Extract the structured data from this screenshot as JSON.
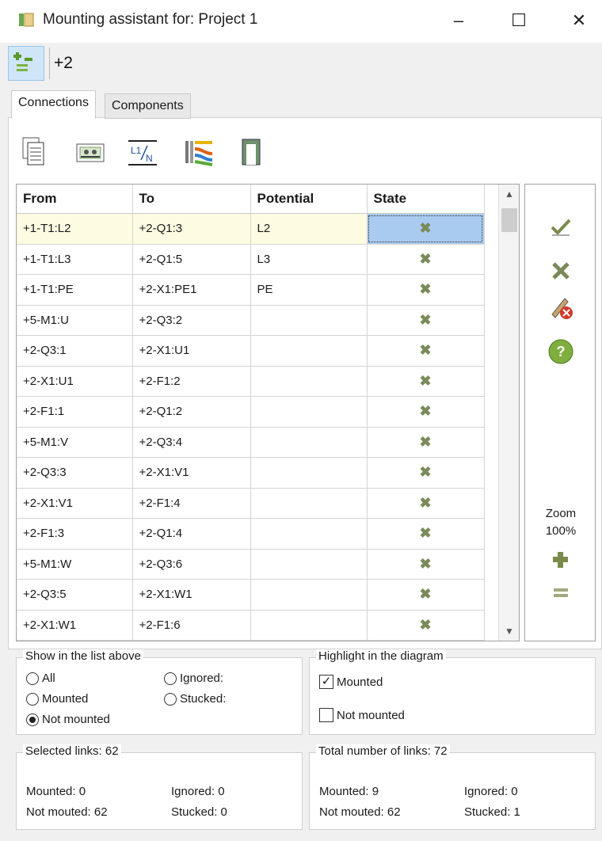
{
  "window": {
    "title": "Mounting assistant for: Project 1",
    "minimize_glyph": "–",
    "maximize_glyph": "☐",
    "close_glyph": "✕"
  },
  "toolbar": {
    "location_label": "+2"
  },
  "tabs": [
    {
      "label": "Connections",
      "active": true
    },
    {
      "label": "Components",
      "active": false
    }
  ],
  "icons": [
    "document-icon",
    "terminal-icon",
    "potential-l1n-icon",
    "cable-colors-icon",
    "device-icon"
  ],
  "table": {
    "columns": [
      "From",
      "To",
      "Potential",
      "State"
    ],
    "rows": [
      {
        "from": "+1-T1:L2",
        "to": "+2-Q1:3",
        "potential": "L2",
        "state": "not-mounted",
        "selected": true
      },
      {
        "from": "+1-T1:L3",
        "to": "+2-Q1:5",
        "potential": "L3",
        "state": "not-mounted"
      },
      {
        "from": "+1-T1:PE",
        "to": "+2-X1:PE1",
        "potential": "PE",
        "state": "not-mounted"
      },
      {
        "from": "+5-M1:U",
        "to": "+2-Q3:2",
        "potential": "",
        "state": "not-mounted"
      },
      {
        "from": "+2-Q3:1",
        "to": "+2-X1:U1",
        "potential": "",
        "state": "not-mounted"
      },
      {
        "from": "+2-X1:U1",
        "to": "+2-F1:2",
        "potential": "",
        "state": "not-mounted"
      },
      {
        "from": "+2-F1:1",
        "to": "+2-Q1:2",
        "potential": "",
        "state": "not-mounted"
      },
      {
        "from": "+5-M1:V",
        "to": "+2-Q3:4",
        "potential": "",
        "state": "not-mounted"
      },
      {
        "from": "+2-Q3:3",
        "to": "+2-X1:V1",
        "potential": "",
        "state": "not-mounted"
      },
      {
        "from": "+2-X1:V1",
        "to": "+2-F1:4",
        "potential": "",
        "state": "not-mounted"
      },
      {
        "from": "+2-F1:3",
        "to": "+2-Q1:4",
        "potential": "",
        "state": "not-mounted"
      },
      {
        "from": "+5-M1:W",
        "to": "+2-Q3:6",
        "potential": "",
        "state": "not-mounted"
      },
      {
        "from": "+2-Q3:5",
        "to": "+2-X1:W1",
        "potential": "",
        "state": "not-mounted"
      },
      {
        "from": "+2-X1:W1",
        "to": "+2-F1:6",
        "potential": "",
        "state": "not-mounted"
      }
    ]
  },
  "side": {
    "zoom_label": "Zoom",
    "zoom_value": "100%"
  },
  "show_group": {
    "title": "Show in the list above",
    "options": [
      {
        "label": "All",
        "checked": false
      },
      {
        "label": "Ignored:",
        "checked": false
      },
      {
        "label": "Mounted",
        "checked": false
      },
      {
        "label": "Stucked:",
        "checked": false
      },
      {
        "label": "Not mounted",
        "checked": true
      }
    ]
  },
  "highlight_group": {
    "title": "Highlight in the diagram",
    "options": [
      {
        "label": "Mounted",
        "checked": true
      },
      {
        "label": "Not mounted",
        "checked": false
      }
    ]
  },
  "selected_stats": {
    "title": "Selected links: 62",
    "mounted": "Mounted: 0",
    "not_mounted": "Not mouted: 62",
    "ignored": "Ignored: 0",
    "stucked": "Stucked: 0"
  },
  "total_stats": {
    "title": "Total number of links: 72",
    "mounted": "Mounted: 9",
    "not_mounted": "Not mouted: 62",
    "ignored": "Ignored: 0",
    "stucked": "Stucked: 1"
  },
  "colors": {
    "selection": "#a9cbf0",
    "selected_row": "#fdfbe1",
    "toolbar_active": "#cfe6f8"
  }
}
